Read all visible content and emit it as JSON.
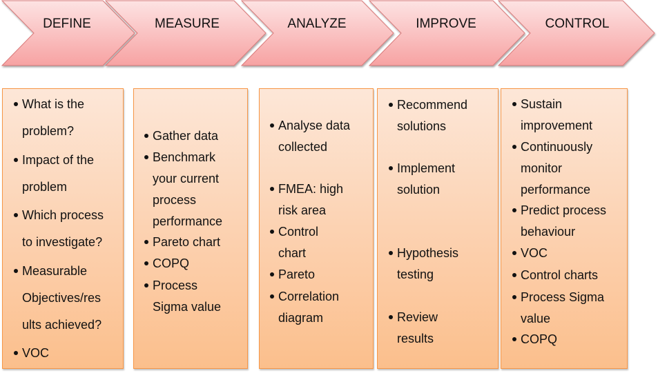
{
  "colors": {
    "chevron_top": "#fde0e0",
    "chevron_bottom": "#f8a3a3",
    "chevron_border": "#d97a7a",
    "box_border": "#f79646",
    "box_top": "#fde7d8",
    "box_bottom": "#fbbf8c"
  },
  "phases": [
    {
      "label": "DEFINE",
      "items": [
        [
          "What is the",
          "problem?"
        ],
        [
          "Impact of the",
          "problem"
        ],
        [
          "Which process",
          "to investigate?"
        ],
        [
          "Measurable",
          "Objectives/res",
          "ults achieved?"
        ],
        [
          "VOC"
        ]
      ]
    },
    {
      "label": "MEASURE",
      "items": [
        [
          "Gather data"
        ],
        [
          "Benchmark",
          "your current",
          "process",
          "performance"
        ],
        [
          "Pareto chart"
        ],
        [
          "COPQ"
        ],
        [
          "Process",
          "Sigma value"
        ]
      ]
    },
    {
      "label": "ANALYZE",
      "items": [
        [
          "Analyse data",
          "collected"
        ],
        [
          "FMEA: high",
          "risk area"
        ],
        [
          "Control",
          "chart"
        ],
        [
          "Pareto"
        ],
        [
          "Correlation",
          "diagram"
        ]
      ]
    },
    {
      "label": "IMPROVE",
      "items": [
        [
          "Recommend",
          "solutions"
        ],
        [
          "Implement",
          "solution"
        ],
        [
          "Hypothesis",
          "testing"
        ],
        [
          "Review",
          "results"
        ]
      ]
    },
    {
      "label": "CONTROL",
      "items": [
        [
          "Sustain",
          "improvement"
        ],
        [
          "Continuously",
          "monitor",
          "performance"
        ],
        [
          "Predict process",
          "behaviour"
        ],
        [
          "VOC"
        ],
        [
          "Control charts"
        ],
        [
          " Process Sigma",
          "value"
        ],
        [
          "COPQ"
        ]
      ]
    }
  ]
}
